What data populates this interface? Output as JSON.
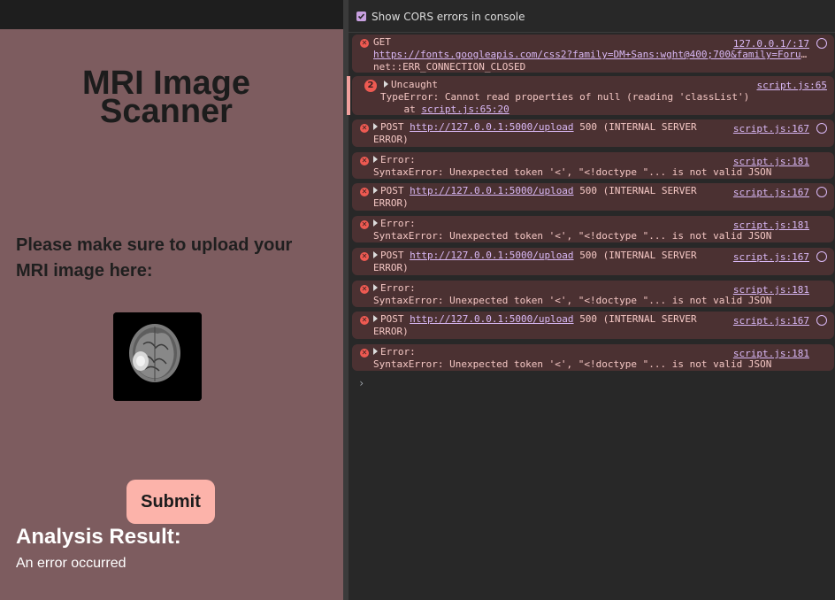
{
  "app": {
    "title": "MRI Image Scanner",
    "title_line1": "MRI Image",
    "title_line2": "Scanner",
    "instructions": "Please make sure to upload your MRI image here:",
    "submit_label": "Submit",
    "result_heading": "Analysis Result:",
    "result_text": "An error occurred"
  },
  "console": {
    "cors_label": "Show CORS errors in console",
    "cors_checked": true,
    "messages": [
      {
        "line1": "GET",
        "url": "https://fonts.googleapis.com/css2?family=DM+Sans:wght@400;700&family=Forum…",
        "line3": "net::ERR_CONNECTION_CLOSED",
        "source": "127.0.0.1/:17"
      },
      {
        "count": "2",
        "line1": "Uncaught",
        "line2": "TypeError: Cannot read properties of null (reading 'classList')",
        "line3_prefix": "    at ",
        "line3_link": "script.js:65:20",
        "source": "script.js:65"
      },
      {
        "method": "POST",
        "url": "http://127.0.0.1:5000/upload",
        "status": "500 (INTERNAL SERVER",
        "status2": "ERROR)",
        "source": "script.js:167"
      },
      {
        "line1": "Error:",
        "line2": "SyntaxError: Unexpected token '<', \"<!doctype \"... is not valid JSON",
        "source": "script.js:181"
      },
      {
        "method": "POST",
        "url": "http://127.0.0.1:5000/upload",
        "status": "500 (INTERNAL SERVER",
        "status2": "ERROR)",
        "source": "script.js:167"
      },
      {
        "line1": "Error:",
        "line2": "SyntaxError: Unexpected token '<', \"<!doctype \"... is not valid JSON",
        "source": "script.js:181"
      },
      {
        "method": "POST",
        "url": "http://127.0.0.1:5000/upload",
        "status": "500 (INTERNAL SERVER",
        "status2": "ERROR)",
        "source": "script.js:167"
      },
      {
        "line1": "Error:",
        "line2": "SyntaxError: Unexpected token '<', \"<!doctype \"... is not valid JSON",
        "source": "script.js:181"
      },
      {
        "method": "POST",
        "url": "http://127.0.0.1:5000/upload",
        "status": "500 (INTERNAL SERVER",
        "status2": "ERROR)",
        "source": "script.js:167"
      },
      {
        "line1": "Error:",
        "line2": "SyntaxError: Unexpected token '<', \"<!doctype \"... is not valid JSON",
        "source": "script.js:181"
      }
    ],
    "prompt_symbol": "›"
  },
  "colors": {
    "page_bg": "#7d5c5f",
    "submit_bg": "#fcb3aa",
    "error_row_bg": "#4b3132",
    "error_icon": "#ee5a52",
    "link": "#d9b8f5"
  },
  "icons": {
    "error": "error-circle-icon",
    "clock": "network-clock-icon",
    "expand": "triangle-right-icon",
    "checkbox": "checkbox-checked-icon"
  }
}
